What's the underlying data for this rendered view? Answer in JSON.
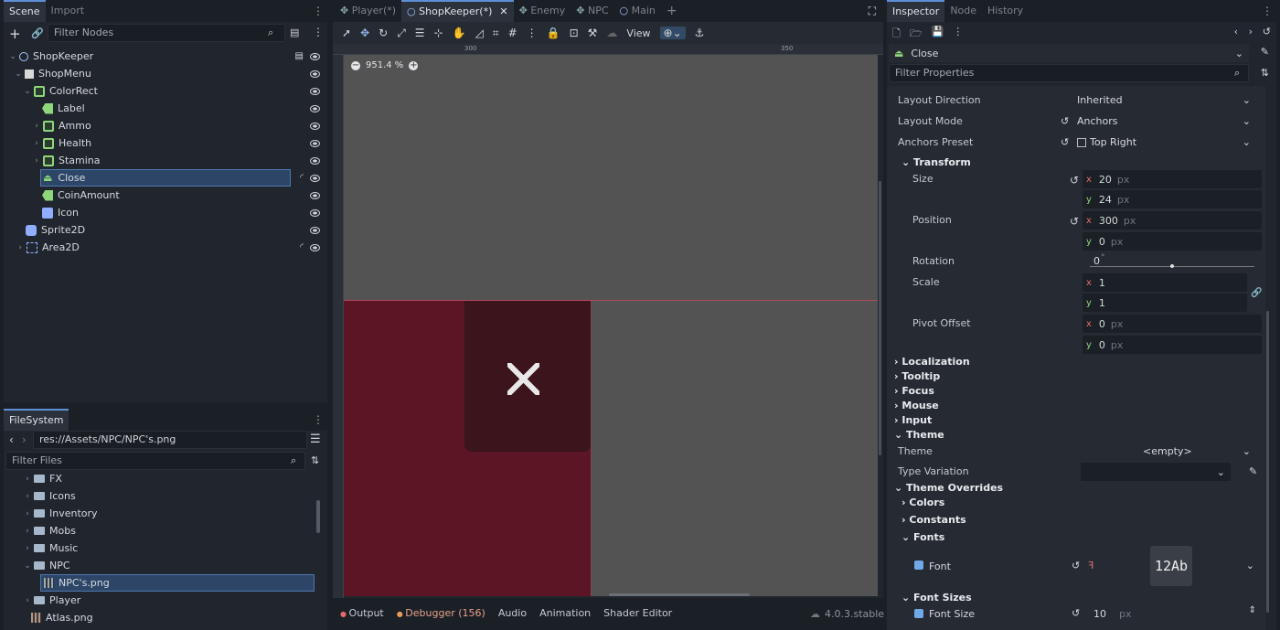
{
  "scene": {
    "tabs": [
      "Scene",
      "Import"
    ],
    "filter_placeholder": "Filter Nodes",
    "nodes": [
      "ShopKeeper",
      "ShopMenu",
      "ColorRect",
      "Label",
      "Ammo",
      "Health",
      "Stamina",
      "Close",
      "CoinAmount",
      "Icon",
      "Sprite2D",
      "Area2D"
    ]
  },
  "fs": {
    "title": "FileSystem",
    "path": "res://Assets/NPC/NPC's.png",
    "filter_placeholder": "Filter Files",
    "items": [
      "FX",
      "Icons",
      "Inventory",
      "Mobs",
      "Music",
      "NPC",
      "NPC's.png",
      "Player",
      "Atlas.png"
    ]
  },
  "editor": {
    "tabs": [
      "Player(*)",
      "ShopKeeper(*)",
      "Enemy",
      "NPC",
      "Main"
    ],
    "view_label": "View",
    "zoom": "951.4 %",
    "ruler": [
      "300",
      "350"
    ],
    "bottom_tabs": [
      "Output",
      "Debugger (156)",
      "Audio",
      "Animation",
      "Shader Editor"
    ],
    "version": "4.0.3.stable"
  },
  "inspector": {
    "tabs": [
      "Inspector",
      "Node",
      "History"
    ],
    "node": "Close",
    "filter_placeholder": "Filter Properties",
    "layout_direction": {
      "k": "Layout Direction",
      "v": "Inherited"
    },
    "layout_mode": {
      "k": "Layout Mode",
      "v": "Anchors"
    },
    "anchors_preset": {
      "k": "Anchors Preset",
      "v": "Top Right"
    },
    "transform": "Transform",
    "size": {
      "k": "Size",
      "x": "20",
      "y": "24",
      "unit": "px"
    },
    "position": {
      "k": "Position",
      "x": "300",
      "y": "0",
      "unit": "px"
    },
    "rotation": {
      "k": "Rotation",
      "v": "0",
      "unit": "°"
    },
    "scale": {
      "k": "Scale",
      "x": "1",
      "y": "1"
    },
    "pivot": {
      "k": "Pivot Offset",
      "x": "0",
      "y": "0",
      "unit": "px"
    },
    "sections": [
      "Localization",
      "Tooltip",
      "Focus",
      "Mouse",
      "Input",
      "Theme"
    ],
    "theme": {
      "k": "Theme",
      "v": "<empty>"
    },
    "type_variation": {
      "k": "Type Variation"
    },
    "overrides": "Theme Overrides",
    "sub": [
      "Colors",
      "Constants",
      "Fonts"
    ],
    "font": {
      "k": "Font",
      "preview": "12Ab"
    },
    "font_sizes": "Font Sizes",
    "font_size": {
      "k": "Font Size",
      "v": "10",
      "unit": "px"
    }
  },
  "colors": {
    "accent": "#5e8fd6",
    "node_green": "#8ed77b",
    "canvas_red": "#5c1524",
    "canvas_gray": "#535353"
  }
}
